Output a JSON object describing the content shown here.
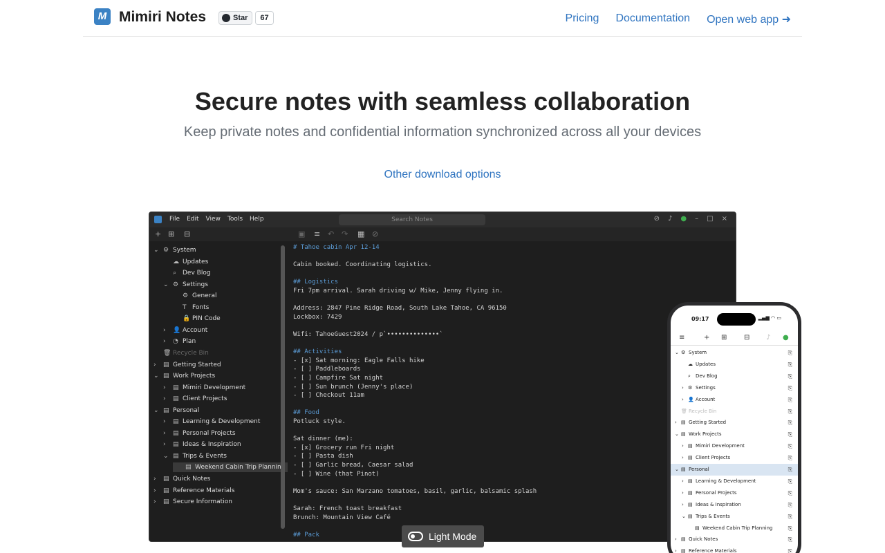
{
  "header": {
    "brand": "Mimiri Notes",
    "github_star_label": "Star",
    "github_star_count": "67",
    "nav": [
      "Pricing",
      "Documentation",
      "Open web app ➜"
    ]
  },
  "hero": {
    "title": "Secure notes with seamless collaboration",
    "subtitle": "Keep private notes and confidential information synchronized across all your devices",
    "download_link": "Other download options"
  },
  "desktop_app": {
    "menus": [
      "File",
      "Edit",
      "View",
      "Tools",
      "Help"
    ],
    "search_placeholder": "Search Notes",
    "tree": [
      {
        "label": "System",
        "depth": 0,
        "chev": "⌄",
        "icon": "⚙"
      },
      {
        "label": "Updates",
        "depth": 1,
        "chev": "",
        "icon": "☁"
      },
      {
        "label": "Dev Blog",
        "depth": 1,
        "chev": "",
        "icon": "⌕"
      },
      {
        "label": "Settings",
        "depth": 1,
        "chev": "⌄",
        "icon": "⚙"
      },
      {
        "label": "General",
        "depth": 2,
        "chev": "",
        "icon": "⚙"
      },
      {
        "label": "Fonts",
        "depth": 2,
        "chev": "",
        "icon": "T"
      },
      {
        "label": "PIN Code",
        "depth": 2,
        "chev": "",
        "icon": "🔒"
      },
      {
        "label": "Account",
        "depth": 1,
        "chev": "›",
        "icon": "👤"
      },
      {
        "label": "Plan",
        "depth": 1,
        "chev": "›",
        "icon": "◔"
      },
      {
        "label": "Recycle Bin",
        "depth": 0,
        "chev": "",
        "icon": "🗑",
        "dim": true
      },
      {
        "label": "Getting Started",
        "depth": 0,
        "chev": "›",
        "icon": "▤"
      },
      {
        "label": "Work Projects",
        "depth": 0,
        "chev": "⌄",
        "icon": "▤"
      },
      {
        "label": "Mimiri Development",
        "depth": 1,
        "chev": "›",
        "icon": "▤"
      },
      {
        "label": "Client Projects",
        "depth": 1,
        "chev": "›",
        "icon": "▤"
      },
      {
        "label": "Personal",
        "depth": 0,
        "chev": "⌄",
        "icon": "▤"
      },
      {
        "label": "Learning & Development",
        "depth": 1,
        "chev": "›",
        "icon": "▤"
      },
      {
        "label": "Personal Projects",
        "depth": 1,
        "chev": "›",
        "icon": "▤"
      },
      {
        "label": "Ideas & Inspiration",
        "depth": 1,
        "chev": "›",
        "icon": "▤"
      },
      {
        "label": "Trips & Events",
        "depth": 1,
        "chev": "⌄",
        "icon": "▤"
      },
      {
        "label": "Weekend Cabin Trip Planning",
        "depth": 2,
        "chev": "",
        "icon": "▤",
        "selected": true
      },
      {
        "label": "Quick Notes",
        "depth": 0,
        "chev": "›",
        "icon": "▤"
      },
      {
        "label": "Reference Materials",
        "depth": 0,
        "chev": "›",
        "icon": "▤"
      },
      {
        "label": "Secure Information",
        "depth": 0,
        "chev": "›",
        "icon": "▤"
      }
    ],
    "editor_lines": [
      {
        "text": "# Tahoe cabin Apr 12-14",
        "h": true,
        "row": 0
      },
      {
        "text": "Cabin booked. Coordinating logistics.",
        "row": 2
      },
      {
        "text": "## Logistics",
        "h": true,
        "row": 4
      },
      {
        "text": "Fri 7pm arrival. Sarah driving w/ Mike, Jenny flying in.",
        "row": 5
      },
      {
        "text": "Address: 2847 Pine Ridge Road, South Lake Tahoe, CA 96150",
        "row": 7
      },
      {
        "text": "Lockbox: 7429",
        "row": 8
      },
      {
        "text": "Wifi: TahoeGuest2024 / p`••••••••••••••`",
        "row": 10
      },
      {
        "text": "## Activities",
        "h": true,
        "row": 12
      },
      {
        "text": "- [x] Sat morning: Eagle Falls hike",
        "row": 13
      },
      {
        "text": "- [ ] Paddleboards",
        "row": 14
      },
      {
        "text": "- [ ] Campfire Sat night",
        "row": 15
      },
      {
        "text": "- [ ] Sun brunch (Jenny's place)",
        "row": 16
      },
      {
        "text": "- [ ] Checkout 11am",
        "row": 17
      },
      {
        "text": "## Food",
        "h": true,
        "row": 19
      },
      {
        "text": "Potluck style.",
        "row": 20
      },
      {
        "text": "Sat dinner (me):",
        "row": 22
      },
      {
        "text": "- [x] Grocery run Fri night",
        "row": 23
      },
      {
        "text": "- [ ] Pasta dish",
        "row": 24
      },
      {
        "text": "- [ ] Garlic bread, Caesar salad",
        "row": 25
      },
      {
        "text": "- [ ] Wine (that Pinot)",
        "row": 26
      },
      {
        "text": "Mom's sauce: San Marzano tomatoes, basil, garlic, balsamic splash",
        "row": 28
      },
      {
        "text": "Sarah: French toast breakfast",
        "row": 30
      },
      {
        "text": "Brunch: Mountain View Café",
        "row": 31
      },
      {
        "text": "## Pack",
        "h": true,
        "row": 33
      }
    ]
  },
  "light_mode_label": "Light Mode",
  "phone": {
    "time": "09:17",
    "tree": [
      {
        "label": "System",
        "depth": 0,
        "chev": "⌄",
        "icon": "⚙"
      },
      {
        "label": "Updates",
        "depth": 1,
        "chev": "",
        "icon": "☁"
      },
      {
        "label": "Dev Blog",
        "depth": 1,
        "chev": "",
        "icon": "⌕"
      },
      {
        "label": "Settings",
        "depth": 1,
        "chev": "›",
        "icon": "⚙"
      },
      {
        "label": "Account",
        "depth": 1,
        "chev": "›",
        "icon": "👤"
      },
      {
        "label": "Recycle Bin",
        "depth": 0,
        "chev": "",
        "icon": "🗑",
        "dim": true
      },
      {
        "label": "Getting Started",
        "depth": 0,
        "chev": "›",
        "icon": "▤"
      },
      {
        "label": "Work Projects",
        "depth": 0,
        "chev": "⌄",
        "icon": "▤"
      },
      {
        "label": "Mimiri Development",
        "depth": 1,
        "chev": "›",
        "icon": "▤"
      },
      {
        "label": "Client Projects",
        "depth": 1,
        "chev": "›",
        "icon": "▤"
      },
      {
        "label": "Personal",
        "depth": 0,
        "chev": "⌄",
        "icon": "▤",
        "selected": true
      },
      {
        "label": "Learning & Development",
        "depth": 1,
        "chev": "›",
        "icon": "▤"
      },
      {
        "label": "Personal Projects",
        "depth": 1,
        "chev": "›",
        "icon": "▤"
      },
      {
        "label": "Ideas & Inspiration",
        "depth": 1,
        "chev": "›",
        "icon": "▤"
      },
      {
        "label": "Trips & Events",
        "depth": 1,
        "chev": "⌄",
        "icon": "▤"
      },
      {
        "label": "Weekend Cabin Trip Planning",
        "depth": 2,
        "chev": "",
        "icon": "▤"
      },
      {
        "label": "Quick Notes",
        "depth": 0,
        "chev": "›",
        "icon": "▤"
      },
      {
        "label": "Reference Materials",
        "depth": 0,
        "chev": "›",
        "icon": "▤"
      }
    ]
  }
}
